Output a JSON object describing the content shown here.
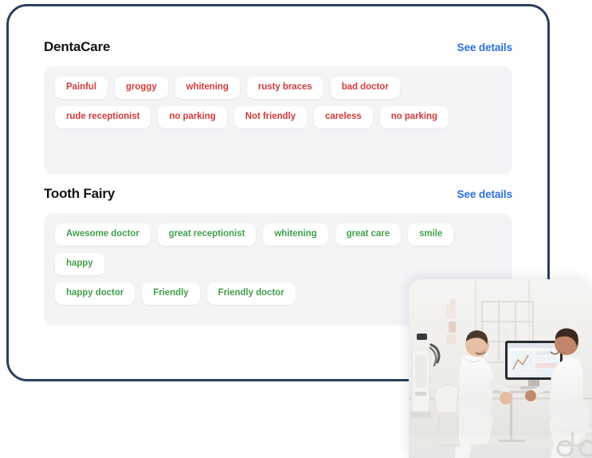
{
  "colors": {
    "border": "#2c3e60",
    "panel_bg": "#f3f4f6",
    "link": "#2b6fe0",
    "negative": "#d33b3b",
    "positive": "#43a04a"
  },
  "sections": [
    {
      "title": "DentaCare",
      "link_label": "See details",
      "sentiment": "negative",
      "rows": [
        [
          "Painful",
          "groggy",
          "whitening",
          "rusty braces",
          "bad doctor"
        ],
        [
          "rude receptionist",
          "no parking",
          "Not friendly",
          "careless",
          "no parking"
        ]
      ]
    },
    {
      "title": "Tooth Fairy",
      "link_label": "See details",
      "sentiment": "positive",
      "rows": [
        [
          "Awesome doctor",
          "great receptionist",
          "whitening",
          "great care",
          "smile",
          "happy"
        ],
        [
          "happy doctor",
          "Friendly",
          "Friendly doctor"
        ]
      ]
    }
  ],
  "photo": {
    "alt": "Dental consultation: two people seated at a table with a desktop monitor in a bright white clinic room"
  }
}
